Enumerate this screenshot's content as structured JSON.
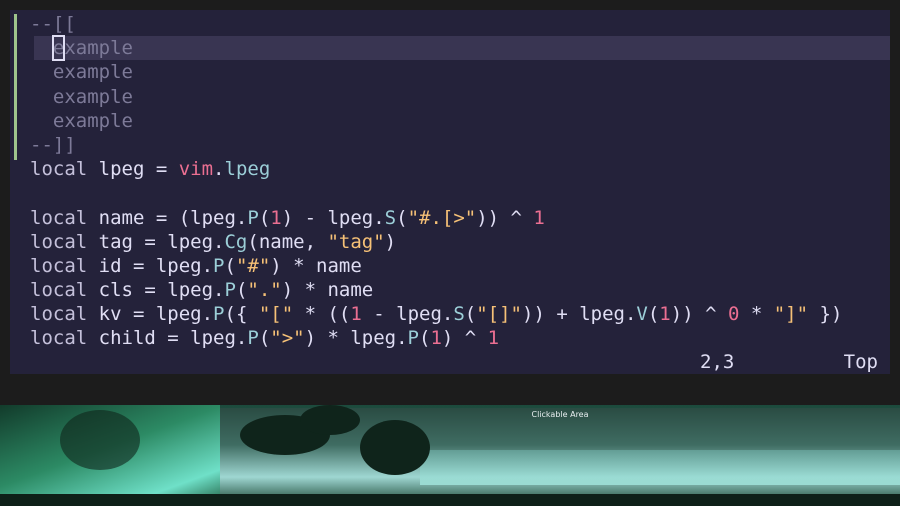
{
  "editor": {
    "lines": [
      [
        {
          "c": "cmt",
          "t": "--[["
        }
      ],
      [
        {
          "c": "cmt",
          "t": "  "
        },
        {
          "c": "cursor",
          "t": "e"
        },
        {
          "c": "cmt",
          "t": "xample"
        }
      ],
      [
        {
          "c": "cmt",
          "t": "  example"
        }
      ],
      [
        {
          "c": "cmt",
          "t": "  example"
        }
      ],
      [
        {
          "c": "cmt",
          "t": "  example"
        }
      ],
      [
        {
          "c": "cmt",
          "t": "--]]"
        }
      ],
      [
        {
          "c": "kw",
          "t": "local"
        },
        {
          "c": "txt",
          "t": " lpeg = "
        },
        {
          "c": "vim",
          "t": "vim"
        },
        {
          "c": "txt",
          "t": "."
        },
        {
          "c": "fn",
          "t": "lpeg"
        }
      ],
      [],
      [
        {
          "c": "kw",
          "t": "local"
        },
        {
          "c": "txt",
          "t": " name = (lpeg."
        },
        {
          "c": "fn",
          "t": "P"
        },
        {
          "c": "txt",
          "t": "("
        },
        {
          "c": "num",
          "t": "1"
        },
        {
          "c": "txt",
          "t": ") - lpeg."
        },
        {
          "c": "fn",
          "t": "S"
        },
        {
          "c": "txt",
          "t": "("
        },
        {
          "c": "str",
          "t": "\"#.[>\""
        },
        {
          "c": "txt",
          "t": ")) ^ "
        },
        {
          "c": "num",
          "t": "1"
        }
      ],
      [
        {
          "c": "kw",
          "t": "local"
        },
        {
          "c": "txt",
          "t": " tag = lpeg."
        },
        {
          "c": "fn",
          "t": "Cg"
        },
        {
          "c": "txt",
          "t": "(name, "
        },
        {
          "c": "str",
          "t": "\"tag\""
        },
        {
          "c": "txt",
          "t": ")"
        }
      ],
      [
        {
          "c": "kw",
          "t": "local"
        },
        {
          "c": "txt",
          "t": " id = lpeg."
        },
        {
          "c": "fn",
          "t": "P"
        },
        {
          "c": "txt",
          "t": "("
        },
        {
          "c": "str",
          "t": "\"#\""
        },
        {
          "c": "txt",
          "t": ") * name"
        }
      ],
      [
        {
          "c": "kw",
          "t": "local"
        },
        {
          "c": "txt",
          "t": " cls = lpeg."
        },
        {
          "c": "fn",
          "t": "P"
        },
        {
          "c": "txt",
          "t": "("
        },
        {
          "c": "str",
          "t": "\".\""
        },
        {
          "c": "txt",
          "t": ") * name"
        }
      ],
      [
        {
          "c": "kw",
          "t": "local"
        },
        {
          "c": "txt",
          "t": " kv = lpeg."
        },
        {
          "c": "fn",
          "t": "P"
        },
        {
          "c": "txt",
          "t": "({ "
        },
        {
          "c": "str",
          "t": "\"[\""
        },
        {
          "c": "txt",
          "t": " * (("
        },
        {
          "c": "num",
          "t": "1"
        },
        {
          "c": "txt",
          "t": " - lpeg."
        },
        {
          "c": "fn",
          "t": "S"
        },
        {
          "c": "txt",
          "t": "("
        },
        {
          "c": "str",
          "t": "\"[]\""
        },
        {
          "c": "txt",
          "t": ")) + lpeg."
        },
        {
          "c": "fn",
          "t": "V"
        },
        {
          "c": "txt",
          "t": "("
        },
        {
          "c": "num",
          "t": "1"
        },
        {
          "c": "txt",
          "t": ")) ^ "
        },
        {
          "c": "num",
          "t": "0"
        },
        {
          "c": "txt",
          "t": " * "
        },
        {
          "c": "str",
          "t": "\"]\""
        },
        {
          "c": "txt",
          "t": " })"
        }
      ],
      [
        {
          "c": "kw",
          "t": "local"
        },
        {
          "c": "txt",
          "t": " child = lpeg."
        },
        {
          "c": "fn",
          "t": "P"
        },
        {
          "c": "txt",
          "t": "("
        },
        {
          "c": "str",
          "t": "\">\""
        },
        {
          "c": "txt",
          "t": ") * lpeg."
        },
        {
          "c": "fn",
          "t": "P"
        },
        {
          "c": "txt",
          "t": "("
        },
        {
          "c": "num",
          "t": "1"
        },
        {
          "c": "txt",
          "t": ") ^ "
        },
        {
          "c": "num",
          "t": "1"
        }
      ]
    ],
    "current_line_index": 1
  },
  "statusline": {
    "cursor_position": "2,3",
    "scroll_position": "Top"
  },
  "desktop": {
    "clickable_label": "Clickable Area"
  },
  "colors": {
    "editor_bg": "#24223a",
    "current_line_bg": "#393552",
    "gutter_accent": "#9ec48c"
  }
}
